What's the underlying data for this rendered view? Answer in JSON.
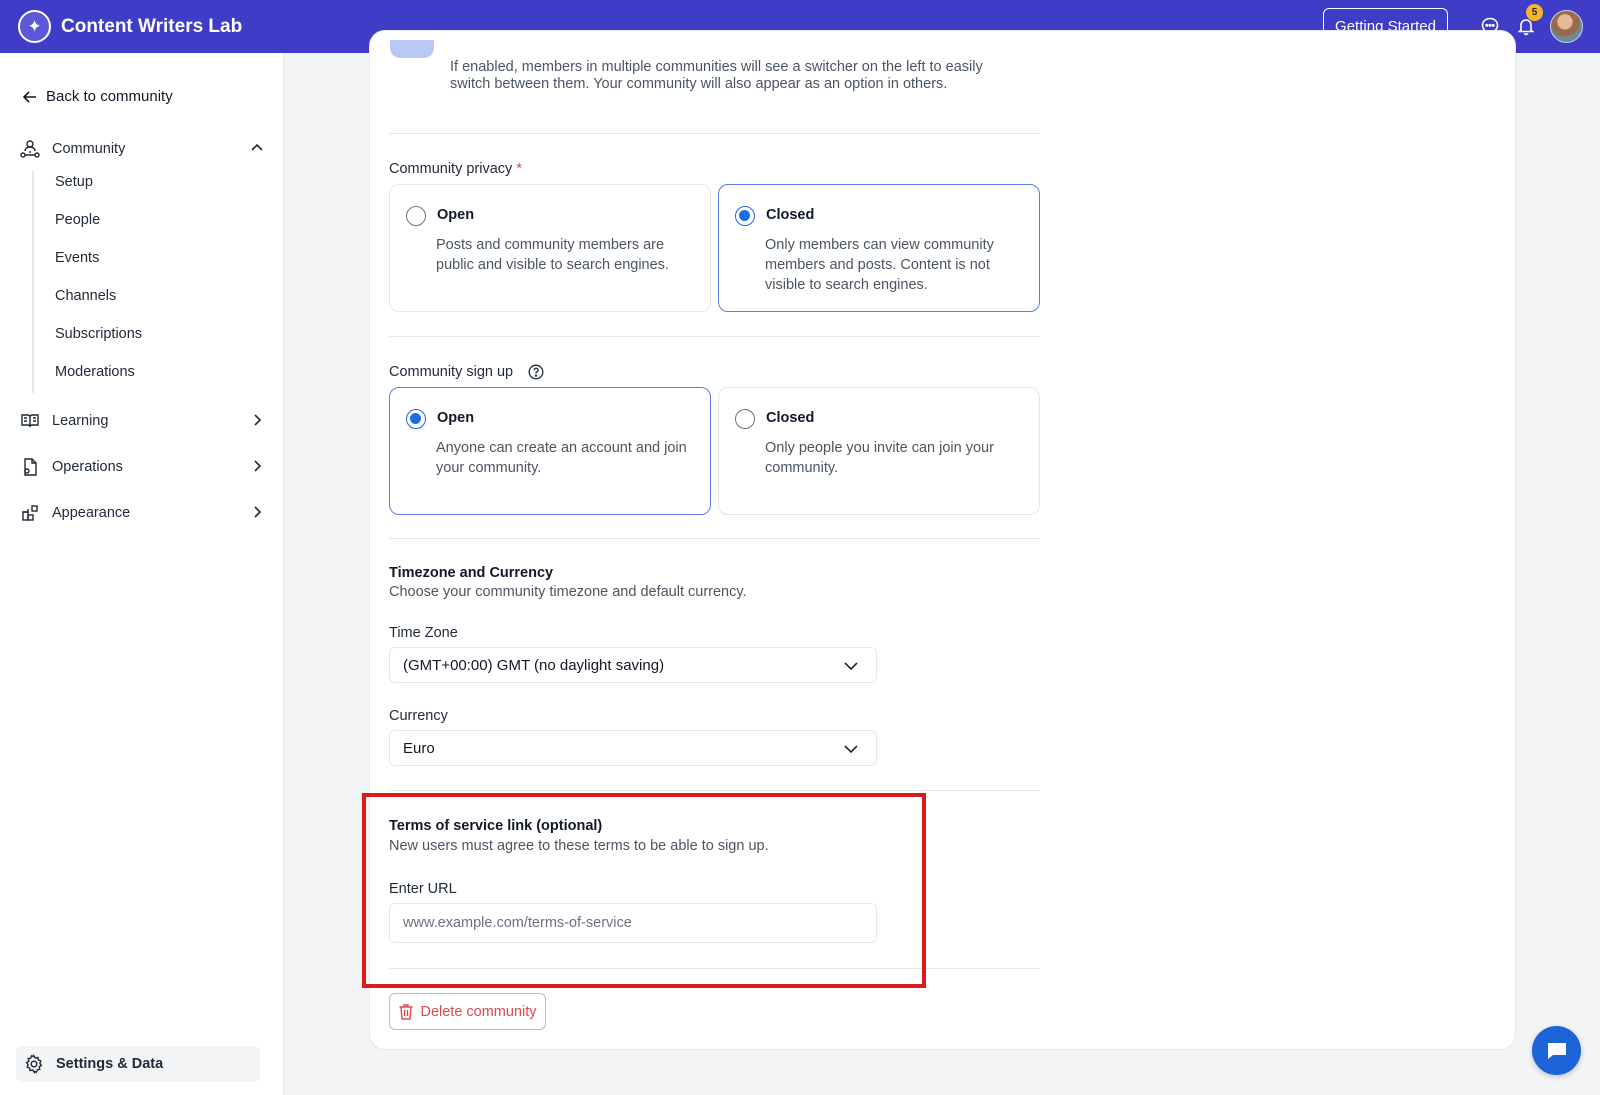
{
  "header": {
    "app_name": "Content Writers Lab",
    "getting_started_label": "Getting Started",
    "notification_count": "5"
  },
  "sidebar": {
    "back_label": "Back to community",
    "community_label": "Community",
    "community_items": [
      "Setup",
      "People",
      "Events",
      "Channels",
      "Subscriptions",
      "Moderations"
    ],
    "learning_label": "Learning",
    "operations_label": "Operations",
    "appearance_label": "Appearance",
    "settings_label": "Settings & Data"
  },
  "main": {
    "switcher_help": "If enabled, members in multiple communities will see a switcher on the left to easily switch between them. Your community will also appear as an option in others.",
    "privacy": {
      "label": "Community privacy",
      "required_mark": "*",
      "options": [
        {
          "title": "Open",
          "desc": "Posts and community members are public and visible to search engines.",
          "selected": false
        },
        {
          "title": "Closed",
          "desc": "Only members can view community members and posts. Content is not visible to search engines.",
          "selected": true
        }
      ]
    },
    "signup": {
      "label": "Community sign up",
      "options": [
        {
          "title": "Open",
          "desc": "Anyone can create an account and join your community.",
          "selected": true
        },
        {
          "title": "Closed",
          "desc": "Only people you invite can join your community.",
          "selected": false
        }
      ]
    },
    "tz_currency": {
      "title": "Timezone and Currency",
      "desc": "Choose your community timezone and default currency.",
      "timezone_label": "Time Zone",
      "timezone_value": "(GMT+00:00) GMT (no daylight saving)",
      "currency_label": "Currency",
      "currency_value": "Euro"
    },
    "tos": {
      "title": "Terms of service link (optional)",
      "desc": "New users must agree to these terms to be able to sign up.",
      "url_label": "Enter URL",
      "url_placeholder": "www.example.com/terms-of-service",
      "url_value": ""
    },
    "delete_label": "Delete community"
  },
  "colors": {
    "header_bg": "#3f3cc8",
    "accent": "#1d6fe0",
    "danger": "#e0484e",
    "highlight": "#d81b1b"
  }
}
